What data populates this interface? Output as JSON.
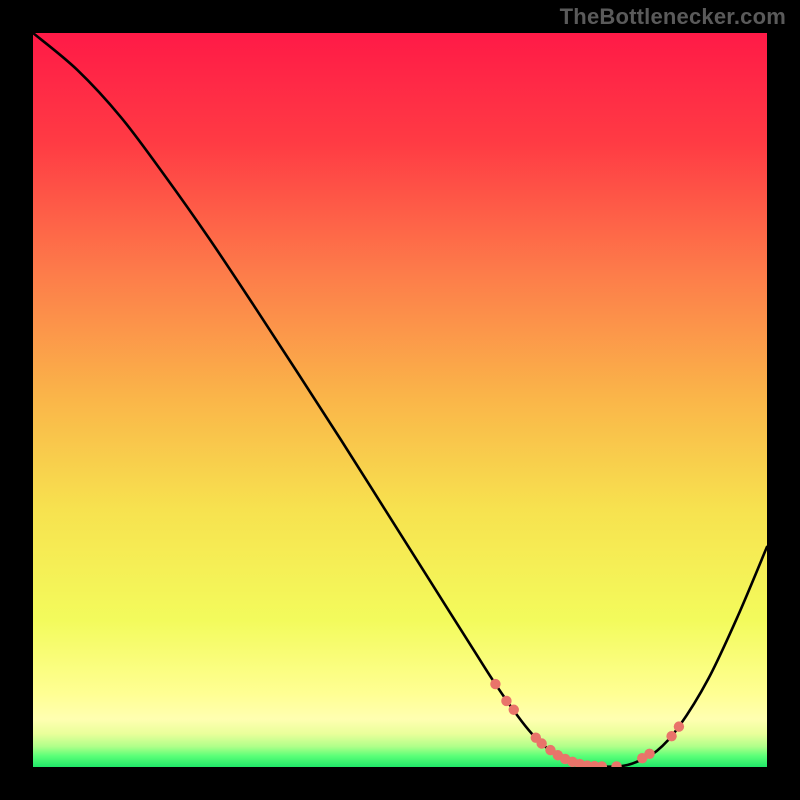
{
  "watermark": "TheBottlenecker.com",
  "chart_data": {
    "type": "line",
    "title": "",
    "xlabel": "",
    "ylabel": "",
    "xlim": [
      0,
      100
    ],
    "ylim": [
      0,
      100
    ],
    "background_gradient": {
      "stops": [
        {
          "offset": 0.0,
          "color": "#ff1a47"
        },
        {
          "offset": 0.15,
          "color": "#ff3b44"
        },
        {
          "offset": 0.33,
          "color": "#fd7d4a"
        },
        {
          "offset": 0.5,
          "color": "#fab649"
        },
        {
          "offset": 0.65,
          "color": "#f7e24f"
        },
        {
          "offset": 0.8,
          "color": "#f3fb5c"
        },
        {
          "offset": 0.9,
          "color": "#ffff93"
        },
        {
          "offset": 0.935,
          "color": "#ffffb1"
        },
        {
          "offset": 0.955,
          "color": "#e9ff9a"
        },
        {
          "offset": 0.972,
          "color": "#b0ff8a"
        },
        {
          "offset": 0.985,
          "color": "#5bff78"
        },
        {
          "offset": 1.0,
          "color": "#20e768"
        }
      ]
    },
    "curve": {
      "x": [
        0,
        6,
        12,
        18,
        24,
        30,
        36,
        42,
        48,
        54,
        60,
        63,
        66,
        68,
        70,
        72,
        74,
        76,
        78,
        80,
        82,
        85,
        88,
        92,
        96,
        100
      ],
      "y": [
        100,
        95,
        88.5,
        80.5,
        72,
        63,
        53.8,
        44.5,
        35,
        25.5,
        16,
        11.3,
        7,
        4.5,
        2.6,
        1.3,
        0.5,
        0.15,
        0.05,
        0.1,
        0.6,
        2.2,
        5.5,
        12,
        20.5,
        30
      ]
    },
    "segment_markers": {
      "color": "#e9746a",
      "radius": 5.2,
      "points": [
        {
          "x": 63.0,
          "y": 11.3
        },
        {
          "x": 64.5,
          "y": 9.0
        },
        {
          "x": 65.5,
          "y": 7.8
        },
        {
          "x": 68.5,
          "y": 4.0
        },
        {
          "x": 69.3,
          "y": 3.2
        },
        {
          "x": 70.5,
          "y": 2.3
        },
        {
          "x": 71.5,
          "y": 1.6
        },
        {
          "x": 72.5,
          "y": 1.1
        },
        {
          "x": 73.5,
          "y": 0.7
        },
        {
          "x": 74.5,
          "y": 0.4
        },
        {
          "x": 75.5,
          "y": 0.2
        },
        {
          "x": 76.5,
          "y": 0.12
        },
        {
          "x": 77.5,
          "y": 0.07
        },
        {
          "x": 79.5,
          "y": 0.08
        },
        {
          "x": 83.0,
          "y": 1.2
        },
        {
          "x": 84.0,
          "y": 1.8
        },
        {
          "x": 87.0,
          "y": 4.2
        },
        {
          "x": 88.0,
          "y": 5.5
        }
      ]
    }
  }
}
